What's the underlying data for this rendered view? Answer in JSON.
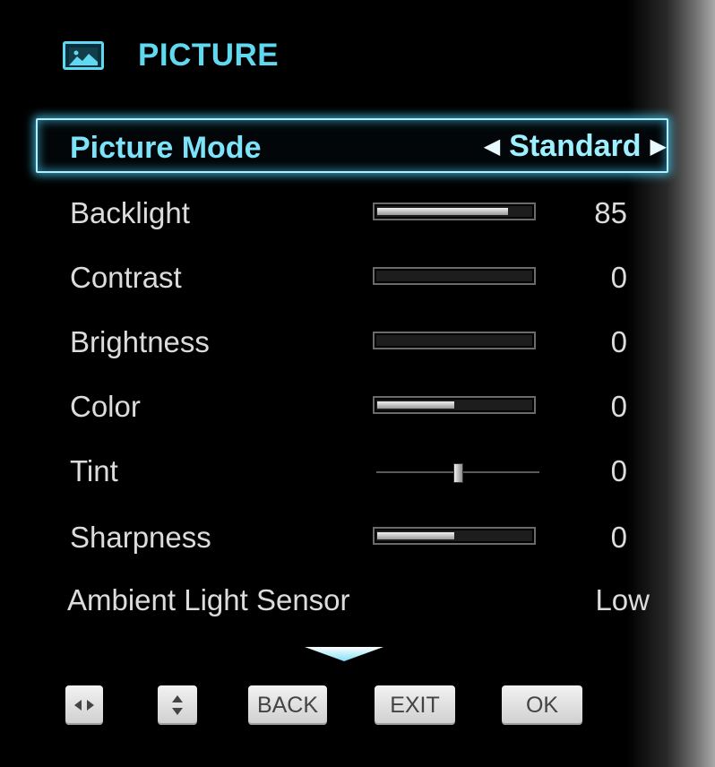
{
  "menu": {
    "title": "PICTURE",
    "icon": "picture-icon",
    "accent_color": "#5fd8f0"
  },
  "picture_mode": {
    "label": "Picture Mode",
    "value": "Standard"
  },
  "settings": [
    {
      "label": "Backlight",
      "value": "85",
      "level": 0.85,
      "control": "bar"
    },
    {
      "label": "Contrast",
      "value": "0",
      "level": 0.0,
      "control": "bar"
    },
    {
      "label": "Brightness",
      "value": "0",
      "level": 0.0,
      "control": "bar"
    },
    {
      "label": "Color",
      "value": "0",
      "level": 0.5,
      "control": "bar"
    },
    {
      "label": "Tint",
      "value": "0",
      "level": 0.5,
      "control": "slider"
    },
    {
      "label": "Sharpness",
      "value": "0",
      "level": 0.5,
      "control": "bar"
    }
  ],
  "ambient_light_sensor": {
    "label": "Ambient Light Sensor",
    "value": "Low"
  },
  "more_indicator": "chevron-down-icon",
  "buttons": {
    "left_right_icon": "left-right-arrows-icon",
    "up_down_icon": "up-down-arrows-icon",
    "back": "BACK",
    "exit": "EXIT",
    "ok": "OK"
  }
}
